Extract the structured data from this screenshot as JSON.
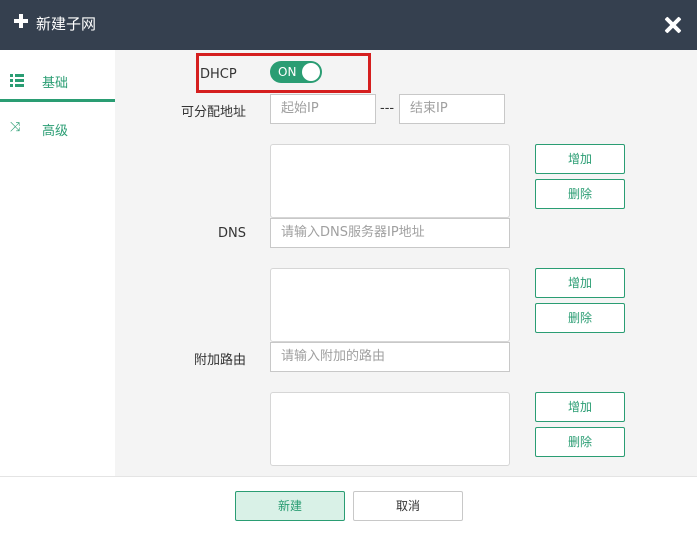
{
  "dialog": {
    "title": "新建子网"
  },
  "sidebar": {
    "items": [
      {
        "label": "基础",
        "icon": "list-icon",
        "active": true
      },
      {
        "label": "高级",
        "icon": "shuffle-icon",
        "active": false
      }
    ]
  },
  "form": {
    "dhcp": {
      "label": "DHCP",
      "state": "ON"
    },
    "ip_range": {
      "label": "可分配地址",
      "start_placeholder": "起始IP",
      "end_placeholder": "结束IP",
      "separator": "---"
    },
    "dns": {
      "label": "DNS",
      "placeholder": "请输入DNS服务器IP地址"
    },
    "extra_route": {
      "label": "附加路由",
      "placeholder": "请输入附加的路由"
    },
    "add_label": "增加",
    "delete_label": "删除"
  },
  "footer": {
    "create_label": "新建",
    "cancel_label": "取消"
  },
  "colors": {
    "accent": "#2a9d73",
    "titlebar": "#35404f",
    "highlight": "#d51f1f"
  }
}
